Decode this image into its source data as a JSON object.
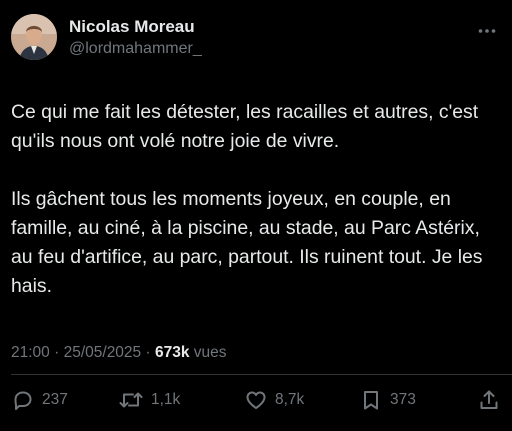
{
  "author": {
    "display_name": "Nicolas Moreau",
    "handle": "@lordmahammer_"
  },
  "tweet": {
    "paragraphs": [
      "Ce qui me fait les détester, les racailles et autres, c'est qu'ils nous ont volé notre joie de vivre.",
      "Ils gâchent tous les moments joyeux, en couple, en famille, au ciné, à la piscine, au stade, au Parc Astérix, au feu d'artifice, au parc, partout. Ils ruinent tout. Je les hais."
    ],
    "time": "21:00",
    "date": "25/05/2025",
    "separator": "·",
    "views_count": "673k",
    "views_label": "vues"
  },
  "actions": {
    "replies": "237",
    "reposts": "1,1k",
    "likes": "8,7k",
    "bookmarks": "373"
  },
  "icons": {
    "more": "more-horizontal-icon",
    "reply": "reply-icon",
    "repost": "repost-icon",
    "like": "heart-icon",
    "bookmark": "bookmark-icon",
    "share": "share-icon"
  },
  "colors": {
    "background": "#000000",
    "primary_text": "#e7e9ea",
    "secondary_text": "#71767b",
    "divider": "#2f3336"
  }
}
